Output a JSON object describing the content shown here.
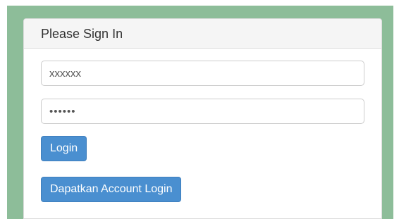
{
  "panel": {
    "title": "Please Sign In"
  },
  "form": {
    "username_value": "xxxxxx",
    "password_value": "xxxxxx",
    "login_label": "Login",
    "account_label": "Dapatkan Account Login"
  },
  "colors": {
    "background": "#8dbd99",
    "button": "#4a8fd0",
    "heading_bg": "#f5f5f5"
  }
}
